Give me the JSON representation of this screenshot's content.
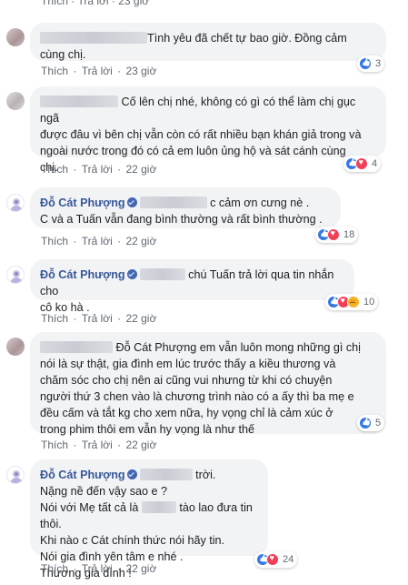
{
  "top_actions": {
    "like": "Thích",
    "reply": "Trả lời",
    "time": "23 giờ"
  },
  "comments": [
    {
      "author": "",
      "lines": [
        "Tình yêu đã chết tự bao giờ. Đồng cảm",
        "cùng chị."
      ],
      "like": "Thích",
      "reply": "Trả lời",
      "time": "23 giờ",
      "reaction_count": "3",
      "reactions": [
        "like-icon"
      ]
    },
    {
      "author": "",
      "lines": [
        "Cố lên chị nhé, không có gì có thể làm chị gục ngã",
        "được đâu vì bên chị vẫn còn có rất nhiều bạn khán giả trong và",
        "ngoài nước trong đó có cả em luôn ủng hộ và sát cánh cùng",
        "chị."
      ],
      "like": "Thích",
      "reply": "Trả lời",
      "time": "22 giờ",
      "reaction_count": "4",
      "reactions": [
        "like-icon",
        "love-icon"
      ]
    },
    {
      "author": "Đỗ Cát Phượng",
      "lines": [
        "c cảm ơn cưng nè .",
        "C và a Tuấn vẫn đang bình thường và rất bình thường ."
      ],
      "like": "Thích",
      "reply": "Trả lời",
      "time": "22 giờ",
      "reaction_count": "18",
      "reactions": [
        "like-icon",
        "love-icon"
      ]
    },
    {
      "author": "Đỗ Cát Phượng",
      "lines": [
        "chú Tuấn trả lời qua tin nhắn cho",
        "cô ko hà ."
      ],
      "like": "Thích",
      "reply": "Trả lời",
      "time": "22 giờ",
      "reaction_count": "10",
      "reactions": [
        "like-icon",
        "love-icon",
        "sad-icon"
      ]
    },
    {
      "author": "",
      "lines": [
        "Đỗ Cát Phượng em vẫn luôn mong những gì chị",
        "nói là sự thật, gia đình em lúc trước thấy a kiều thương và",
        "chăm sóc cho chị nên ai cũng vui nhưng từ khi có chuyện",
        "người thứ 3 chen vào là chương trình nào có a ấy thì ba mẹ e",
        "đều cấm và tắt kg cho xem nữa, hy vọng chỉ là cảm xúc ở",
        "trong phim thôi em vẫn hy vọng là như thế"
      ],
      "like": "Thích",
      "reply": "Trả lời",
      "time": "22 giờ",
      "reaction_count": "5",
      "reactions": [
        "like-icon"
      ]
    },
    {
      "author": "Đỗ Cát Phượng",
      "lines": [
        "trời.",
        "Nặng nề đến vậy sao e ?",
        "Nói với Mẹ tất cả là",
        "tào lao đưa tin thôi.",
        "Khi nào c Cát chính thức nói hãy tin.",
        "Nói gia đình yên tâm e nhé .",
        "Thương gia đình !"
      ],
      "like": "Thích",
      "reply": "Trả lời",
      "time": "22 giờ",
      "reaction_count": "24",
      "reactions": [
        "like-icon",
        "love-icon"
      ]
    }
  ]
}
